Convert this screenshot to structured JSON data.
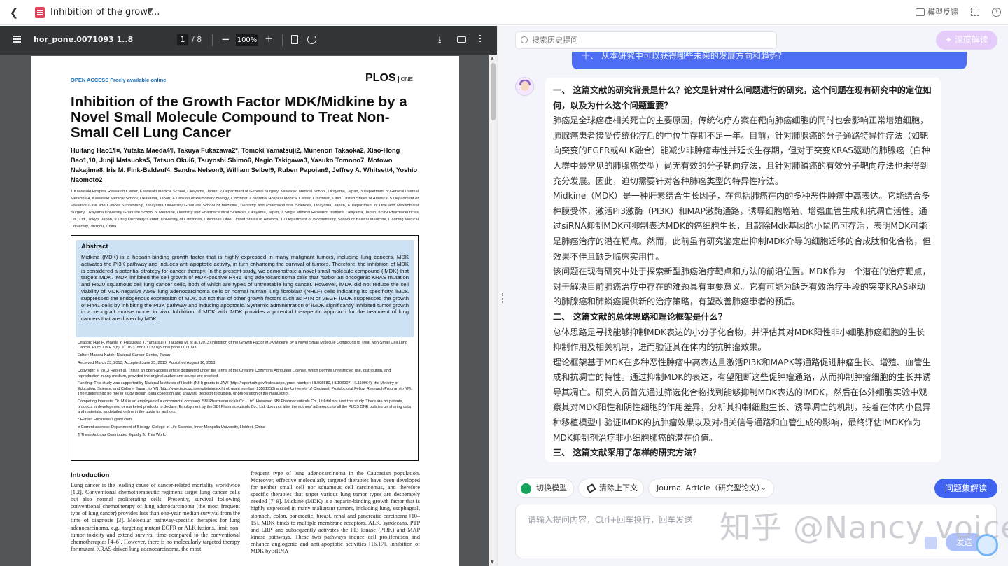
{
  "topbar": {
    "tab_title": "Inhibition of the growt...",
    "feedback_label": "模型反馈"
  },
  "pdf_toolbar": {
    "file_name": "hor_pone.0071093 1..8",
    "page_current": "1",
    "page_total": "/ 8",
    "zoom": "100%"
  },
  "paper": {
    "open_access": "OPEN ACCESS Freely available online",
    "journal": "PLOS",
    "journal_sub": "ONE",
    "title": "Inhibition of the Growth Factor MDK/Midkine by a Novel Small Molecule Compound to Treat Non-Small Cell Lung Cancer",
    "authors": "Huifang Hao1¶¤, Yutaka Maeda4¶, Takuya Fukazawa2*, Tomoki Yamatsuji2, Munenori Takaoka2, Xiao-Hong Bao1,10, Junji Matsuoka5, Tatsuo Okui6, Tsuyoshi Shimo6, Nagio Takigawa3, Yasuko Tomono7, Motowo Nakajima8, Iris M. Fink-Baldauf4, Sandra Nelson9, William Seibel9, Ruben Papoian9, Jeffrey A. Whitsett4, Yoshio Naomoto2",
    "affiliations": "1 Kawasaki Hospital Research Center, Kawasaki Medical School, Okayama, Japan, 2 Department of General Surgery, Kawasaki Medical School, Okayama, Japan, 3 Department of General Internal Medicine 4, Kawasaki Medical School, Okayama, Japan, 4 Division of Pulmonary Biology, Cincinnati Children's Hospital Medical Center, Cincinnati, Ohio, United States of America, 5 Department of Palliative Care and Cancer Survivorship, Okayama University Graduate School of Medicine, Dentistry and Pharmaceutical Sciences, Okayama, Japan, 6 Department of Oral and Maxillofacial Surgery, Okayama University Graduate School of Medicine, Dentistry and Pharmaceutical Sciences, Okayama, Japan, 7 Shigei Medical Research Institute, Okayama, Japan, 8 SBI Pharmaceuticals Co., Ltd., Tokyo, Japan, 9 Drug Discovery Center, University of Cincinnati, Cincinnati Ohio, United States of America, 10 Department of Biochemistry, School of Basical Medicine, Liaoning Medical University, Jinzhou, China",
    "abstract_heading": "Abstract",
    "abstract": "Midkine (MDK) is a heparin-binding growth factor that is highly expressed in many malignant tumors, including lung cancers. MDK activates the PI3K pathway and induces anti-apoptotic activity, in turn enhancing the survival of tumors. Therefore, the inhibition of MDK is considered a potential strategy for cancer therapy. In the present study, we demonstrate a novel small molecule compound (iMDK) that targets MDK. iMDK inhibited the cell growth of MDK-positive H441 lung adenocarcinoma cells that harbor an oncogenic KRAS mutation and H520 squamous cell lung cancer cells, both of which are types of untreatable lung cancer. However, iMDK did not reduce the cell viability of MDK-negative A549 lung adenocarcinoma cells or normal human lung fibroblast (NHLF) cells indicating its specificity. iMDK suppressed the endogenous expression of MDK but not that of other growth factors such as PTN or VEGF. iMDK suppressed the growth of H441 cells by inhibiting the PI3K pathway and inducing apoptosis. Systemic administration of iMDK significantly inhibited tumor growth in a xenograft mouse model in vivo. Inhibition of MDK with iMDK provides a potential therapeutic approach for the treatment of lung cancers that are driven by MDK.",
    "citation": "Citation: Hao H, Maeda Y, Fukazawa T, Yamatsuji T, Takaoka M, et al. (2013) Inhibition of the Growth Factor MDK/Midkine by a Novel Small Molecule Compound to Treat Non-Small Cell Lung Cancer. PLoS ONE 8(8): e71093. doi:10.1371/journal.pone.0071093",
    "editor": "Editor: Masaru Katoh, National Cancer Center, Japan",
    "dates": "Received March 23, 2013; Accepted June 25, 2013; Published August 16, 2013",
    "copyright": "Copyright: © 2013 Hao et al. This is an open-access article distributed under the terms of the Creative Commons Attribution License, which permits unrestricted use, distribution, and reproduction in any medium, provided the original author and source are credited.",
    "funding": "Funding: This study was supported by National Institutes of Health (NIH) grants to JAW (http://report.nih.gov/index.aspx, grant number: HL095580, HL108907, HL110964), the Ministry of Education, Science, and Culture, Japan, to YN (http://www.jsps.go.jp/english/index.html, grant number: 23591950) and the University of Cincinnati Postdoctoral Fellow Research Program to YM. The funders had no role in study design, data collection and analysis, decision to publish, or preparation of the manuscript.",
    "competing": "Competing Interests: Dr. MN is an employee of a commercial company 'SBI Pharmaceuticals Co., Ltd'. However, SBI Pharmaceuticals Co., Ltd did not fund this study. There are no patents, products in development or marketed products to declare. Employment by the SBI Pharmaceuticals Co., Ltd. does not alter the authors' adherence to all the PLOS ONE policies on sharing data and materials, as detailed online in the guide for authors.",
    "email": "* E-mail: FukazawaT@aol.com",
    "current_address": "¤ Current address: Department of Biology, College of Life Science, Inner Mongolia University, Hohhot, China",
    "equal": "¶ These Authors Contributed Equally To This Work.",
    "intro_heading": "Introduction",
    "intro_col1": "Lung cancer is the leading cause of cancer-related mortality worldwide [1,2]. Conventional chemotherapeutic regimens target lung cancer cells but also normal proliferating cells. Presently, survival following conventional chemotherapy of lung adenocarcinoma (the most frequent type of lung cancer) provides less than one-year median survival from the time of diagnosis [3]. Molecular pathway-specific therapies for lung adenocarcinoma, e.g., targeting mutant EGFR or ALK fusions, limit non-tumor toxicity and extend survival time compared to the conventional chemotherapies [4–6]. However, there is no molecularly targeted therapy for mutant KRAS-driven lung adenocarcinoma, the most",
    "intro_col2": "frequent type of lung adenocarcinoma in the Caucasian population. Moreover, effective molecularly targeted therapies have been developed for neither small cell nor squamous cell carcinomas, and therefore specific therapies that target various lung tumor types are desperately needed [7–9]. Midkine (MDK) is a heparin-binding growth factor that is highly expressed in many malignant tumors, including lung, esophageal, stomach, colon, pancreatic, breast, renal and pancreatic carcinoma [10–15]. MDK binds to multiple membrane receptors, ALK, syndecans, PTP and LRP, and subsequently activates the PI3 kinase (PI3K) and MAP kinase pathways. These two pathways induce cell proliferation and enhance angiogenic and anti-apoptotic activities [16,17]. Inhibition of MDK by siRNA"
  },
  "chat": {
    "search_placeholder": "搜索历史提问",
    "deep_button": "✦ 深度解读",
    "question_fragment": "十、  从本研究中可以获得哪些未来的发展方向和趋势？",
    "answer": [
      {
        "type": "h",
        "text": "一、 这篇文献的研究背景是什么？论文是针对什么问题进行的研究，这个问题在现有研究中的定位如何，以及为什么这个问题重要？"
      },
      {
        "type": "p",
        "text": "肺癌是全球癌症相关死亡的主要原因，传统化疗方案在靶向肺癌细胞的同时也会影响正常增殖细胞，肺腺癌患者接受传统化疗后的中位生存期不足一年。目前，针对肺腺癌的分子通路特异性疗法（如靶向突变的EGFR或ALK融合）能减少非肿瘤毒性并延长生存期，但对于突变KRAS驱动的肺腺癌（白种人群中最常见的肺腺癌类型）尚无有效的分子靶向疗法，且针对肺鳞癌的有效分子靶向疗法也未得到充分发展。因此，迫切需要针对各种肺癌类型的特异性疗法。"
      },
      {
        "type": "p",
        "text": "Midkine（MDK）是一种肝素结合生长因子，在包括肺癌在内的多种恶性肿瘤中高表达。它能结合多种膜受体，激活PI3激酶（PI3K）和MAP激酶通路，诱导细胞增殖、增强血管生成和抗凋亡活性。通过siRNA抑制MDK可抑制表达MDK的癌细胞生长，且敲除Mdk基因的小鼠仍可存活，表明MDK可能是肺癌治疗的潜在靶点。然而，此前虽有研究鉴定出抑制MDK介导的细胞迁移的合成肽和化合物，但效果不佳且缺乏临床实用性。"
      },
      {
        "type": "p",
        "text": "该问题在现有研究中处于探索新型肺癌治疗靶点和方法的前沿位置。MDK作为一个潜在的治疗靶点，对于解决目前肺癌治疗中存在的难题具有重要意义。它有可能为缺乏有效治疗手段的突变KRAS驱动的肺腺癌和肺鳞癌提供新的治疗策略，有望改善肺癌患者的预后。"
      },
      {
        "type": "h",
        "text": "二、 这篇文献的总体思路和理论框架是什么？"
      },
      {
        "type": "p",
        "text": "总体思路是寻找能够抑制MDK表达的小分子化合物，并评估其对MDK阳性非小细胞肺癌细胞的生长抑制作用及相关机制，进而验证其在体内的抗肿瘤效果。"
      },
      {
        "type": "p",
        "text": "理论框架基于MDK在多种恶性肿瘤中高表达且激活PI3K和MAPK等通路促进肿瘤生长、增殖、血管生成和抗凋亡的特性。通过抑制MDK的表达，有望阻断这些促肿瘤通路，从而抑制肿瘤细胞的生长并诱导其凋亡。研究人员首先通过筛选化合物找到能够抑制MDK表达的iMDK，然后在体外细胞实验中观察其对MDK阳性和阴性细胞的作用差异，分析其抑制细胞生长、诱导凋亡的机制，接着在体内小鼠异种移植模型中验证iMDK的抗肿瘤效果以及对相关信号通路和血管生成的影响，最终评估iMDK作为MDK抑制剂治疗非小细胞肺癌的潜在价值。"
      },
      {
        "type": "h",
        "text": "三、 这篇文献采用了怎样的研究方法？"
      }
    ],
    "tool_switch": "切换模型",
    "tool_clear": "清除上下文",
    "tool_type": "Journal Article（研究型论文）",
    "batch_button": "问题集解读",
    "input_placeholder": "请输入提问内容，Ctrl+回车换行，回车发送",
    "send_button": "发送",
    "watermark": "知乎 @Nancy voice"
  }
}
